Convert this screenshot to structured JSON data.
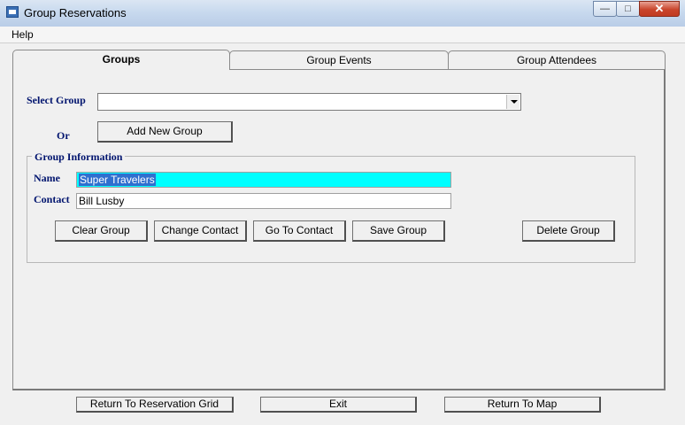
{
  "window": {
    "title": "Group Reservations"
  },
  "menu": {
    "help": "Help"
  },
  "tabs": [
    {
      "label": "Groups",
      "active": true
    },
    {
      "label": "Group Events",
      "active": false
    },
    {
      "label": "Group Attendees",
      "active": false
    }
  ],
  "select_group": {
    "label": "Select Group",
    "value": ""
  },
  "or_label": "Or",
  "add_new_group": "Add New Group",
  "group_info": {
    "legend": "Group Information",
    "name_label": "Name",
    "name_value": "Super Travelers",
    "contact_label": "Contact",
    "contact_value": "Bill Lusby"
  },
  "buttons": {
    "clear_group": "Clear Group",
    "change_contact": "Change Contact",
    "go_to_contact": "Go To Contact",
    "save_group": "Save Group",
    "delete_group": "Delete Group"
  },
  "bottom": {
    "return_grid": "Return To Reservation Grid",
    "exit": "Exit",
    "return_map": "Return To Map"
  },
  "colors": {
    "name_field_bg": "#00ffff",
    "label_color": "#00146e"
  }
}
